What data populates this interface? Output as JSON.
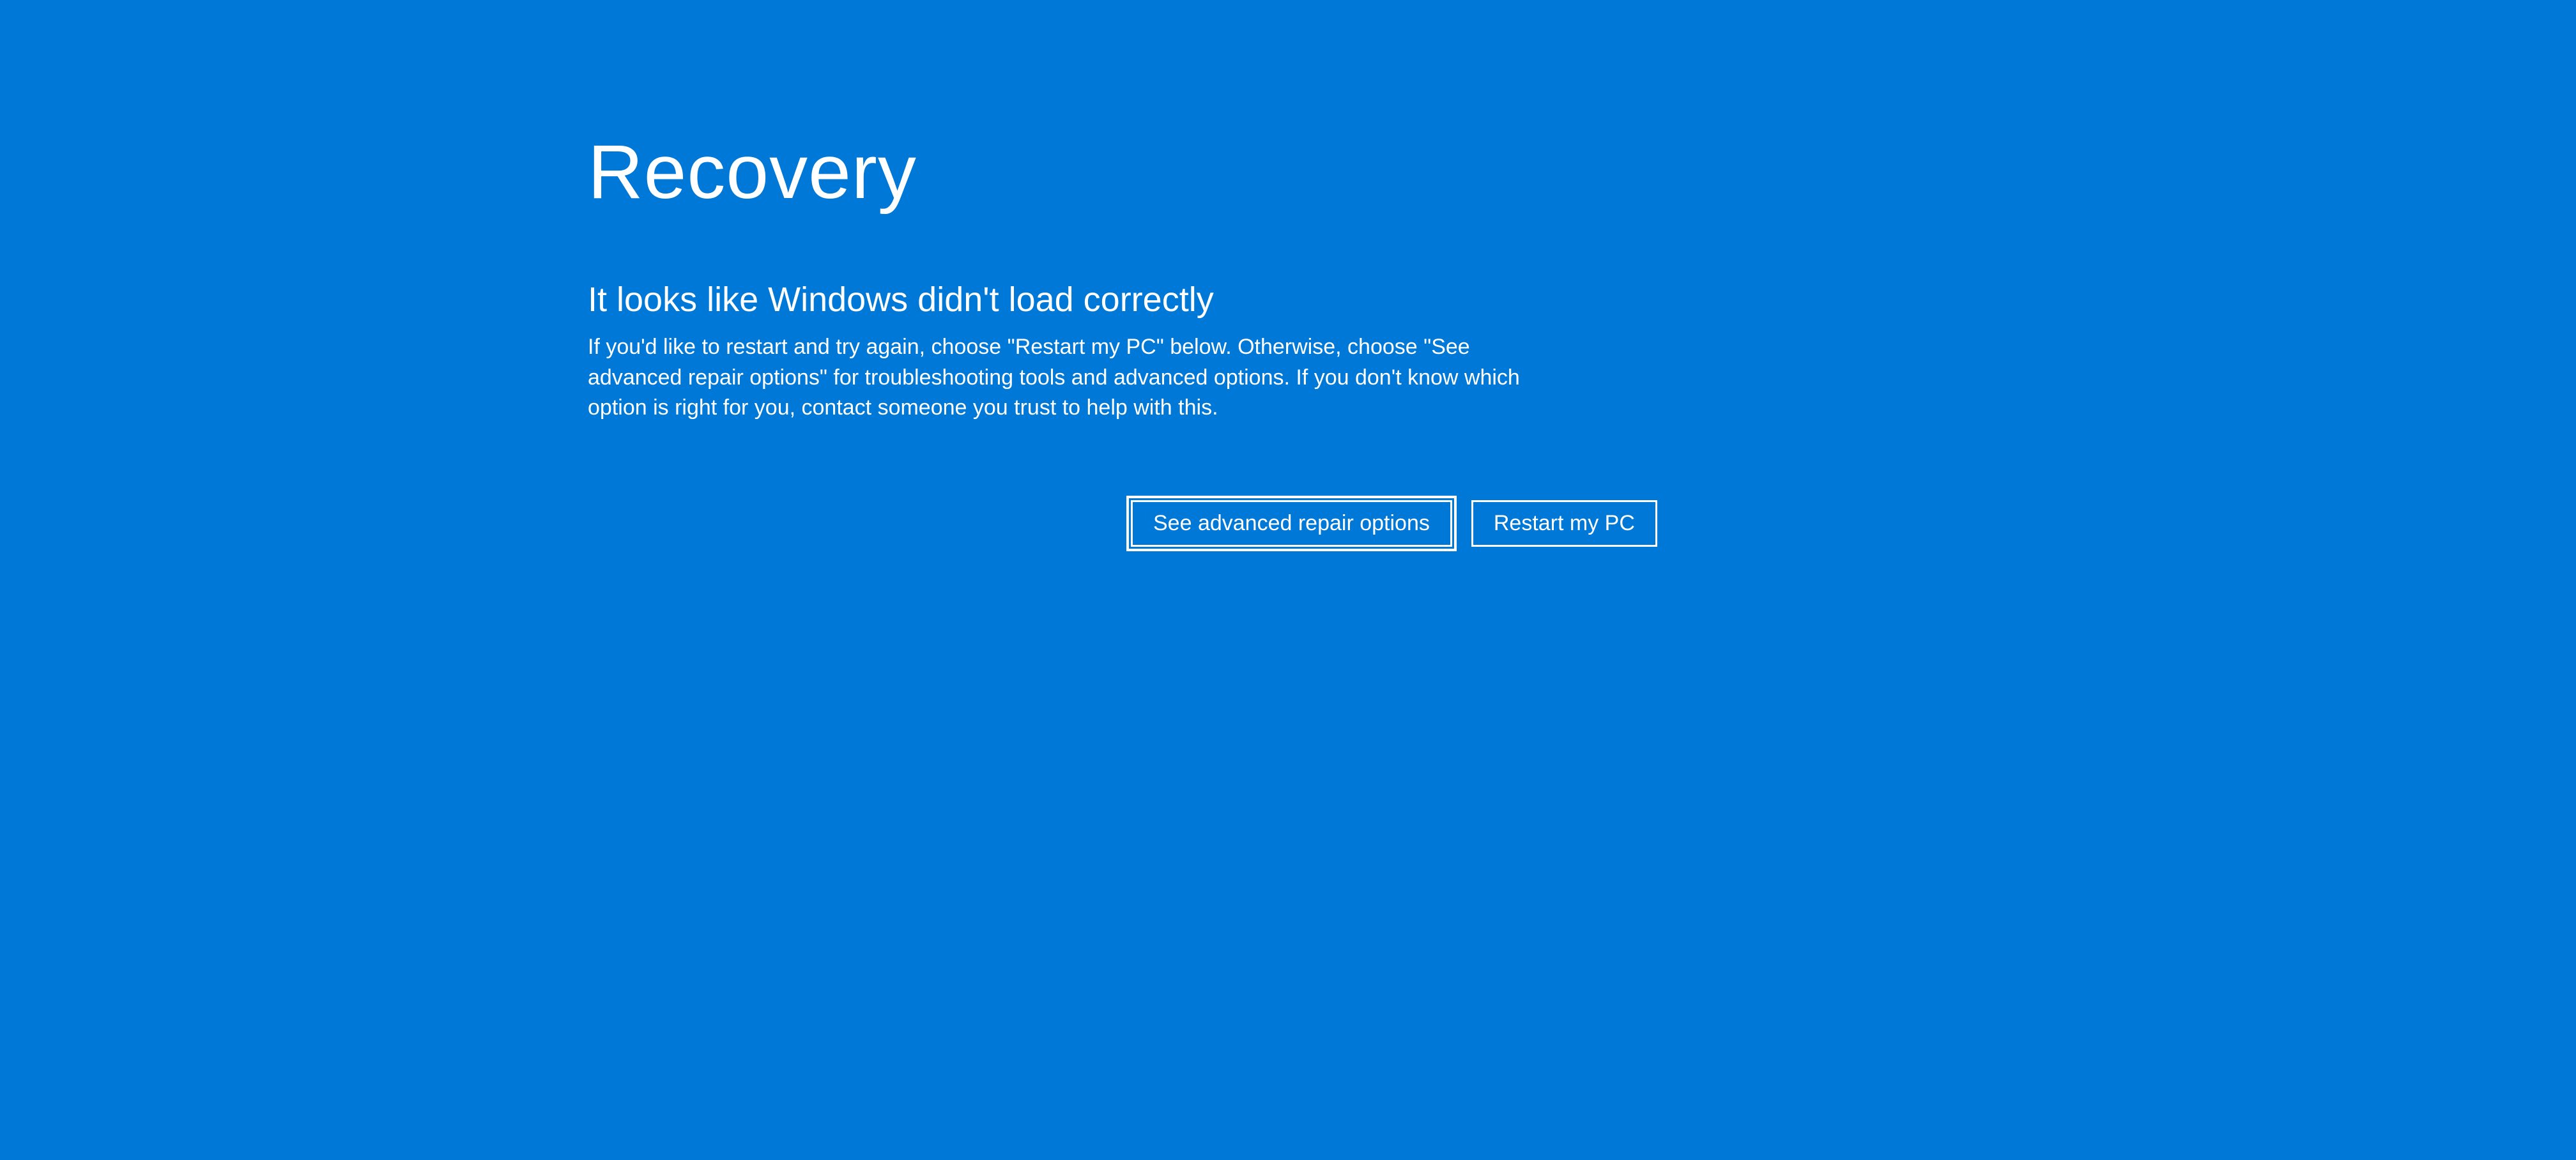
{
  "recovery": {
    "title": "Recovery",
    "subtitle": "It looks like Windows didn't load correctly",
    "body": "If you'd like to restart and try again, choose \"Restart my PC\" below. Otherwise, choose \"See advanced repair options\" for troubleshooting tools and advanced options. If you don't know which option is right for you, contact someone you trust to help with this.",
    "buttons": {
      "advanced": "See advanced repair options",
      "restart": "Restart my PC"
    }
  }
}
